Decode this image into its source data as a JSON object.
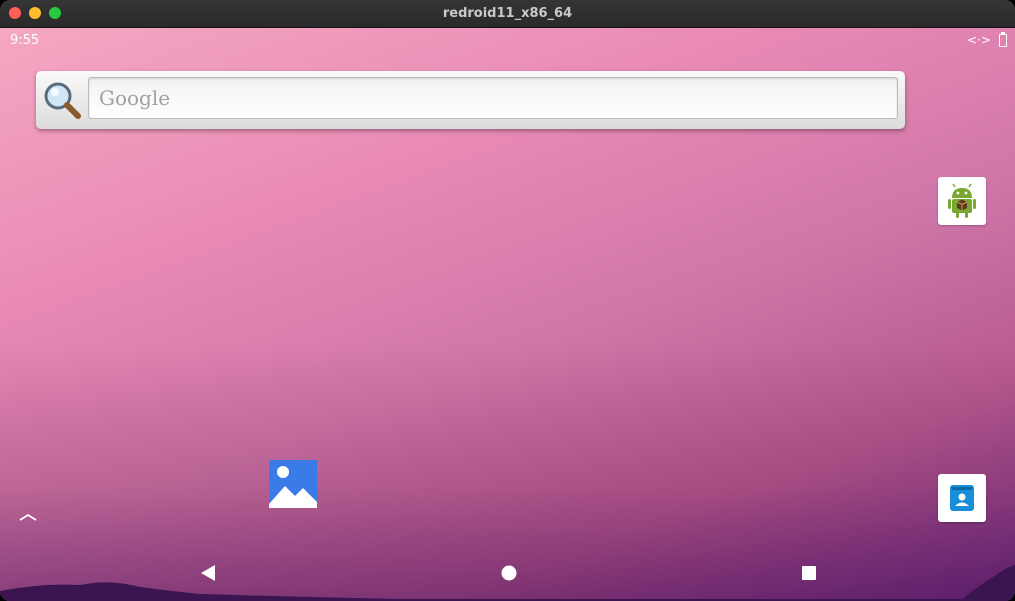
{
  "window": {
    "title": "redroid11_x86_64"
  },
  "status_bar": {
    "time": "9:55",
    "icons": [
      "data-transfer-icon",
      "battery-icon"
    ],
    "data_icon_glyph": "<·>"
  },
  "search_widget": {
    "placeholder": "Google",
    "icon": "magnifier-icon"
  },
  "home_apps": [
    {
      "name": "android-app",
      "icon": "android-robot-icon"
    },
    {
      "name": "contacts-app",
      "icon": "contacts-icon"
    },
    {
      "name": "gallery-app",
      "icon": "gallery-icon"
    }
  ],
  "navigation": {
    "buttons": [
      "back",
      "home",
      "recents"
    ]
  },
  "colors": {
    "traffic_close": "#ff5f57",
    "traffic_minimize": "#febc2e",
    "traffic_zoom": "#28c840",
    "gallery_blue": "#3b7be8",
    "contacts_blue": "#1a8fd9",
    "android_green": "#78a832"
  }
}
